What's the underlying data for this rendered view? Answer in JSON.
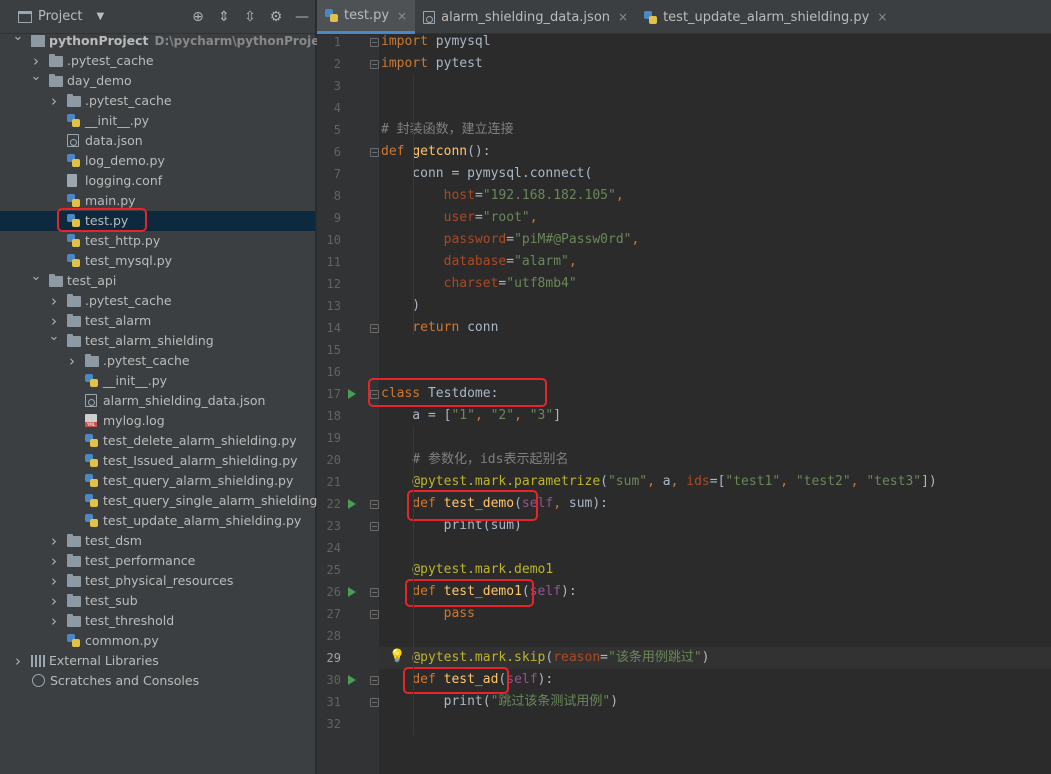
{
  "project_panel": {
    "title": "Project",
    "tool_icons": [
      "locate-icon",
      "expand-all-icon",
      "collapse-all-icon",
      "settings-icon",
      "hide-icon"
    ],
    "tree": [
      {
        "label": "pythonProject",
        "sub": "D:\\pycharm\\pythonProject",
        "type": "project",
        "depth": 0,
        "expanded": true,
        "bold": true
      },
      {
        "label": ".pytest_cache",
        "type": "folder",
        "depth": 1,
        "expanded": false
      },
      {
        "label": "day_demo",
        "type": "folder",
        "depth": 1,
        "expanded": true
      },
      {
        "label": ".pytest_cache",
        "type": "folder",
        "depth": 2,
        "expanded": false
      },
      {
        "label": "__init__.py",
        "type": "py",
        "depth": 2
      },
      {
        "label": "data.json",
        "type": "json",
        "depth": 2
      },
      {
        "label": "log_demo.py",
        "type": "py",
        "depth": 2
      },
      {
        "label": "logging.conf",
        "type": "conf",
        "depth": 2
      },
      {
        "label": "main.py",
        "type": "py",
        "depth": 2
      },
      {
        "label": "test.py",
        "type": "py",
        "depth": 2,
        "selected": true
      },
      {
        "label": "test_http.py",
        "type": "py",
        "depth": 2
      },
      {
        "label": "test_mysql.py",
        "type": "py",
        "depth": 2
      },
      {
        "label": "test_api",
        "type": "folder",
        "depth": 1,
        "expanded": true
      },
      {
        "label": ".pytest_cache",
        "type": "folder",
        "depth": 2,
        "expanded": false
      },
      {
        "label": "test_alarm",
        "type": "folder",
        "depth": 2,
        "expanded": false
      },
      {
        "label": "test_alarm_shielding",
        "type": "folder",
        "depth": 2,
        "expanded": true
      },
      {
        "label": ".pytest_cache",
        "type": "folder",
        "depth": 3,
        "expanded": false
      },
      {
        "label": "__init__.py",
        "type": "py",
        "depth": 3
      },
      {
        "label": "alarm_shielding_data.json",
        "type": "json",
        "depth": 3
      },
      {
        "label": "mylog.log",
        "type": "log",
        "depth": 3
      },
      {
        "label": "test_delete_alarm_shielding.py",
        "type": "py",
        "depth": 3
      },
      {
        "label": "test_Issued_alarm_shielding.py",
        "type": "py",
        "depth": 3
      },
      {
        "label": "test_query_alarm_shielding.py",
        "type": "py",
        "depth": 3
      },
      {
        "label": "test_query_single_alarm_shielding.py",
        "type": "py",
        "depth": 3
      },
      {
        "label": "test_update_alarm_shielding.py",
        "type": "py",
        "depth": 3
      },
      {
        "label": "test_dsm",
        "type": "folder",
        "depth": 2,
        "expanded": false
      },
      {
        "label": "test_performance",
        "type": "folder",
        "depth": 2,
        "expanded": false
      },
      {
        "label": "test_physical_resources",
        "type": "folder",
        "depth": 2,
        "expanded": false
      },
      {
        "label": "test_sub",
        "type": "folder",
        "depth": 2,
        "expanded": false
      },
      {
        "label": "test_threshold",
        "type": "folder",
        "depth": 2,
        "expanded": false
      },
      {
        "label": "common.py",
        "type": "py",
        "depth": 2
      },
      {
        "label": "External Libraries",
        "type": "lib",
        "depth": 0,
        "expanded": false
      },
      {
        "label": "Scratches and Consoles",
        "type": "scratch",
        "depth": 0
      }
    ]
  },
  "tabs": [
    {
      "label": "test.py",
      "type": "py",
      "active": true
    },
    {
      "label": "alarm_shielding_data.json",
      "type": "json",
      "active": false
    },
    {
      "label": "test_update_alarm_shielding.py",
      "type": "py",
      "active": false
    }
  ],
  "editor": {
    "current_line": 29,
    "run_lines": [
      17,
      22,
      26,
      30
    ],
    "fold_lines": [
      1,
      2,
      6,
      14,
      17,
      22,
      23,
      26,
      27,
      30,
      31
    ],
    "bulb_line": 29,
    "lines": [
      {
        "n": 1,
        "t": [
          [
            "kw",
            "import"
          ],
          [
            "plain",
            " pymysql"
          ]
        ]
      },
      {
        "n": 2,
        "t": [
          [
            "kw",
            "import"
          ],
          [
            "plain",
            " pytest"
          ]
        ]
      },
      {
        "n": 3,
        "t": []
      },
      {
        "n": 4,
        "t": []
      },
      {
        "n": 5,
        "t": [
          [
            "cm",
            "# 封装函数，建立连接"
          ]
        ]
      },
      {
        "n": 6,
        "t": [
          [
            "kw",
            "def "
          ],
          [
            "fn",
            "getconn"
          ],
          [
            "plain",
            "():"
          ]
        ]
      },
      {
        "n": 7,
        "t": [
          [
            "plain",
            "    conn = pymysql.connect("
          ]
        ]
      },
      {
        "n": 8,
        "t": [
          [
            "plain",
            "        "
          ],
          [
            "param",
            "host"
          ],
          [
            "plain",
            "="
          ],
          [
            "str",
            "\"192.168.182.105\""
          ],
          [
            "kw",
            ","
          ]
        ]
      },
      {
        "n": 9,
        "t": [
          [
            "plain",
            "        "
          ],
          [
            "param",
            "user"
          ],
          [
            "plain",
            "="
          ],
          [
            "str",
            "\"root\""
          ],
          [
            "kw",
            ","
          ]
        ]
      },
      {
        "n": 10,
        "t": [
          [
            "plain",
            "        "
          ],
          [
            "param",
            "password"
          ],
          [
            "plain",
            "="
          ],
          [
            "str",
            "\"piM#@Passw0rd\""
          ],
          [
            "kw",
            ","
          ]
        ]
      },
      {
        "n": 11,
        "t": [
          [
            "plain",
            "        "
          ],
          [
            "param",
            "database"
          ],
          [
            "plain",
            "="
          ],
          [
            "str",
            "\"alarm\""
          ],
          [
            "kw",
            ","
          ]
        ]
      },
      {
        "n": 12,
        "t": [
          [
            "plain",
            "        "
          ],
          [
            "param",
            "charset"
          ],
          [
            "plain",
            "="
          ],
          [
            "str",
            "\"utf8mb4\""
          ]
        ]
      },
      {
        "n": 13,
        "t": [
          [
            "plain",
            "    )"
          ]
        ]
      },
      {
        "n": 14,
        "t": [
          [
            "plain",
            "    "
          ],
          [
            "kw",
            "return"
          ],
          [
            "plain",
            " conn"
          ]
        ]
      },
      {
        "n": 15,
        "t": []
      },
      {
        "n": 16,
        "t": []
      },
      {
        "n": 17,
        "t": [
          [
            "kw",
            "class "
          ],
          [
            "plain",
            "Testdome:"
          ]
        ]
      },
      {
        "n": 18,
        "t": [
          [
            "plain",
            "    a = ["
          ],
          [
            "str",
            "\"1\""
          ],
          [
            "kw",
            ", "
          ],
          [
            "str",
            "\"2\""
          ],
          [
            "kw",
            ", "
          ],
          [
            "str",
            "\"3\""
          ],
          [
            "plain",
            "]"
          ]
        ]
      },
      {
        "n": 19,
        "t": []
      },
      {
        "n": 20,
        "t": [
          [
            "cm",
            "    # 参数化，ids表示起别名"
          ]
        ]
      },
      {
        "n": 21,
        "t": [
          [
            "dec",
            "    @pytest.mark.parametrize"
          ],
          [
            "plain",
            "("
          ],
          [
            "str",
            "\"sum\""
          ],
          [
            "kw",
            ", "
          ],
          [
            "plain",
            "a"
          ],
          [
            "kw",
            ", "
          ],
          [
            "param",
            "ids"
          ],
          [
            "plain",
            "=["
          ],
          [
            "str",
            "\"test1\""
          ],
          [
            "kw",
            ", "
          ],
          [
            "str",
            "\"test2\""
          ],
          [
            "kw",
            ", "
          ],
          [
            "str",
            "\"test3\""
          ],
          [
            "plain",
            "])"
          ]
        ]
      },
      {
        "n": 22,
        "t": [
          [
            "plain",
            "    "
          ],
          [
            "kw",
            "def "
          ],
          [
            "fn",
            "test_demo"
          ],
          [
            "plain",
            "("
          ],
          [
            "selfkw",
            "self"
          ],
          [
            "kw",
            ", "
          ],
          [
            "plain",
            "sum):"
          ]
        ]
      },
      {
        "n": 23,
        "t": [
          [
            "plain",
            "        print(sum)"
          ]
        ]
      },
      {
        "n": 24,
        "t": []
      },
      {
        "n": 25,
        "t": [
          [
            "dec",
            "    @pytest.mark.demo1"
          ]
        ]
      },
      {
        "n": 26,
        "t": [
          [
            "plain",
            "    "
          ],
          [
            "kw",
            "def "
          ],
          [
            "fn",
            "test_demo1"
          ],
          [
            "plain",
            "("
          ],
          [
            "selfkw",
            "self"
          ],
          [
            "plain",
            "):"
          ]
        ]
      },
      {
        "n": 27,
        "t": [
          [
            "plain",
            "        "
          ],
          [
            "kw",
            "pass"
          ]
        ]
      },
      {
        "n": 28,
        "t": []
      },
      {
        "n": 29,
        "t": [
          [
            "dec",
            "    @pytest.mark.skip"
          ],
          [
            "plain",
            "("
          ],
          [
            "param",
            "reason"
          ],
          [
            "plain",
            "="
          ],
          [
            "str",
            "\"该条用例跳过\""
          ],
          [
            "plain",
            ")"
          ]
        ]
      },
      {
        "n": 30,
        "t": [
          [
            "plain",
            "    "
          ],
          [
            "kw",
            "def "
          ],
          [
            "fn",
            "test_ad"
          ],
          [
            "plain",
            "("
          ],
          [
            "selfkw",
            "self"
          ],
          [
            "plain",
            "):"
          ]
        ]
      },
      {
        "n": 31,
        "t": [
          [
            "plain",
            "        print("
          ],
          [
            "str",
            "\"跳过该条测试用例\""
          ],
          [
            "plain",
            ")"
          ]
        ]
      },
      {
        "n": 32,
        "t": []
      }
    ]
  },
  "colors": {
    "keyword": "#cc7832",
    "function": "#ffc66d",
    "string": "#6a8759",
    "comment": "#808080",
    "decorator": "#bbb529",
    "highlight_box": "#e8242a",
    "selection": "#0d293e"
  }
}
